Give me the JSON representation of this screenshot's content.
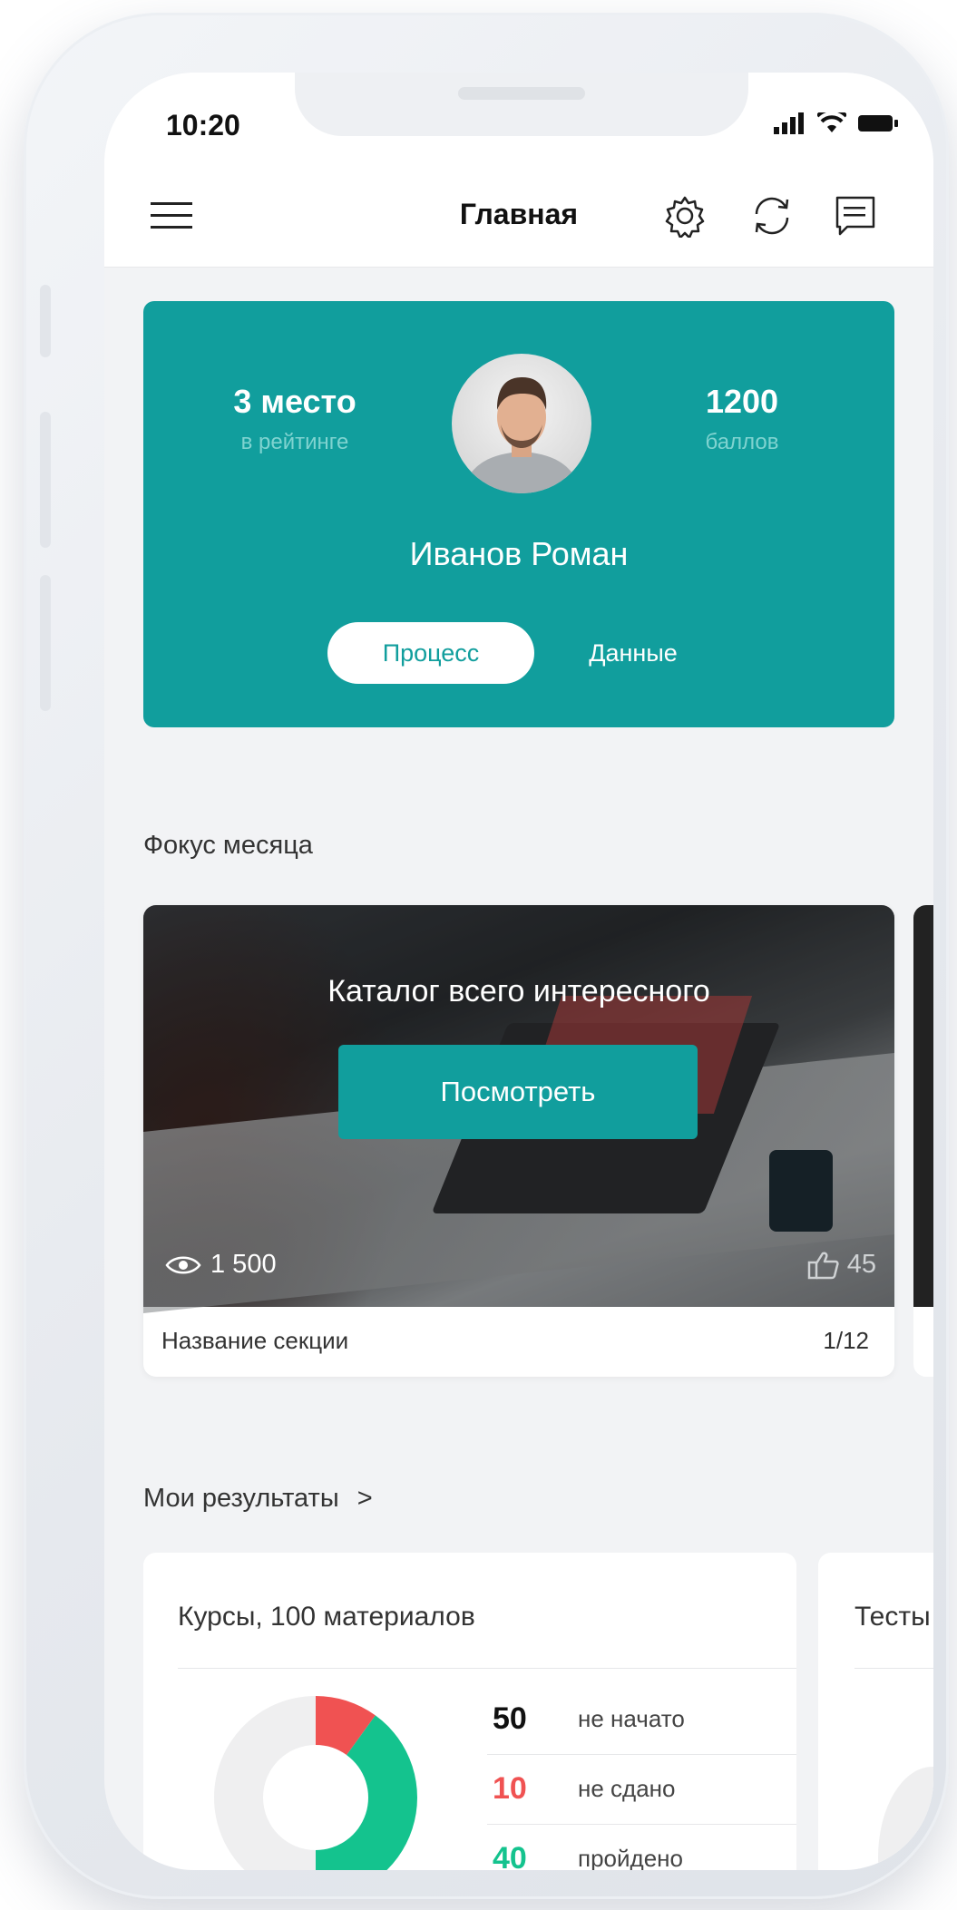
{
  "status_bar": {
    "time": "10:20"
  },
  "nav": {
    "title": "Главная"
  },
  "profile": {
    "rank_value": "3 место",
    "rank_caption": "в рейтинге",
    "points_value": "1200",
    "points_caption": "баллов",
    "name": "Иванов Роман",
    "tabs": [
      {
        "label": "Процесс",
        "active": true
      },
      {
        "label": "Данные",
        "active": false
      }
    ]
  },
  "focus": {
    "header": "Фокус месяца",
    "title": "Каталог всего интересного",
    "button_label": "Посмотреть",
    "views": "1 500",
    "likes": "45",
    "section_name": "Название секции",
    "pager": "1/12"
  },
  "results": {
    "header": "Мои результаты",
    "header_chevron": ">",
    "card_title": "Курсы, 100 материалов",
    "peek_title": "Тесты",
    "rows": [
      {
        "value": "50",
        "label": "не начато",
        "color": "#111111"
      },
      {
        "value": "10",
        "label": "не сдано",
        "color": "#f05252"
      },
      {
        "value": "40",
        "label": "пройдено",
        "color": "#14c38e"
      }
    ]
  },
  "chart_data": {
    "type": "pie",
    "categories": [
      "не начато",
      "не сдано",
      "пройдено"
    ],
    "values": [
      50,
      10,
      40
    ],
    "colors": [
      "#efeff0",
      "#f05252",
      "#14c38e"
    ]
  },
  "colors": {
    "accent": "#119e9d",
    "screen_bg": "#f2f3f5",
    "failed": "#f05252",
    "passed": "#14c38e"
  }
}
